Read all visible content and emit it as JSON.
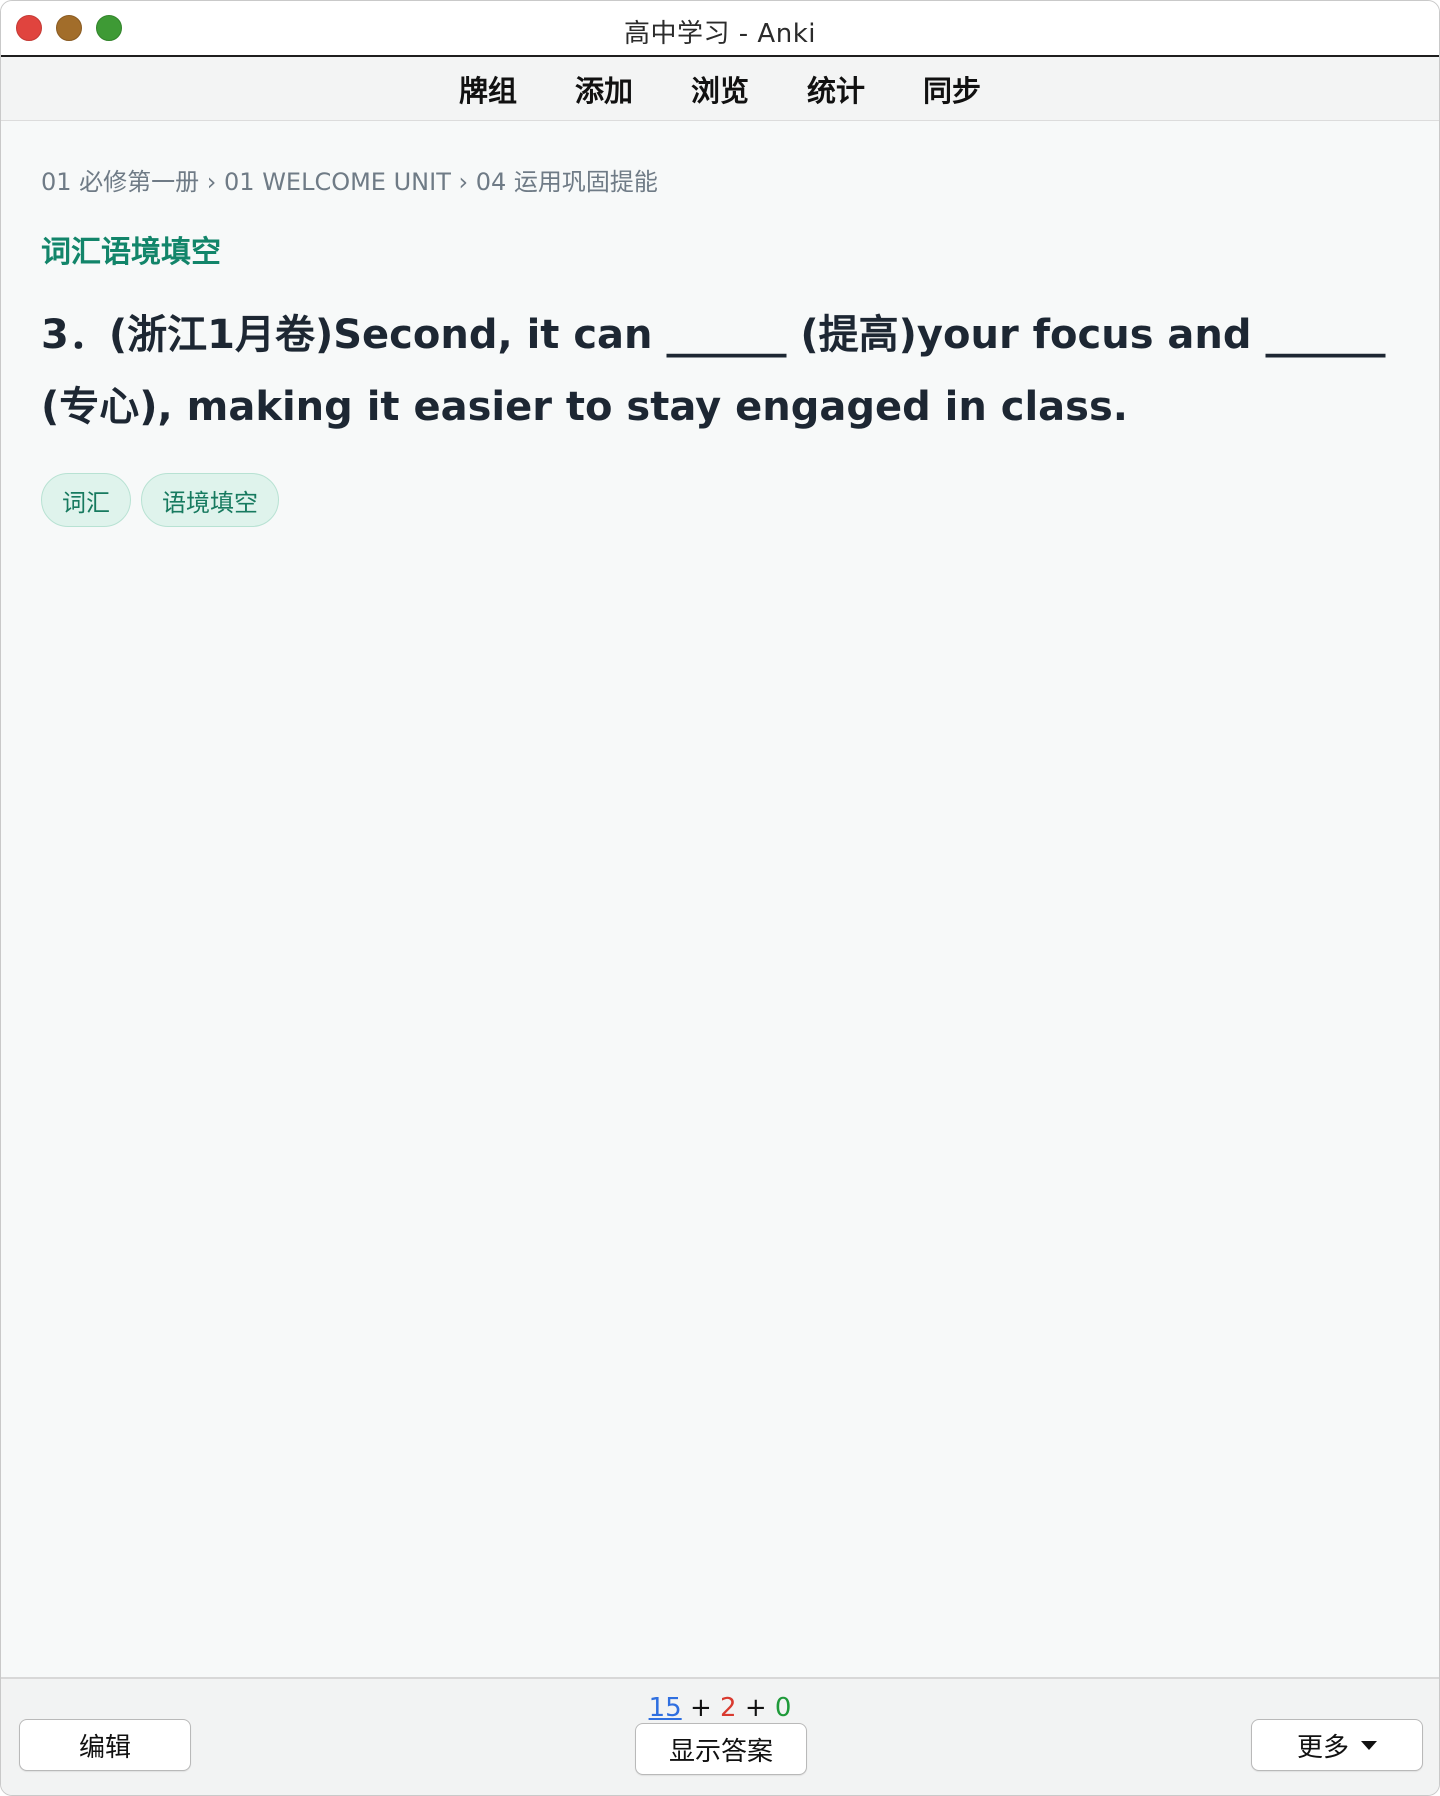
{
  "window": {
    "title": "高中学习 - Anki"
  },
  "toolbar": {
    "items": [
      {
        "label": "牌组"
      },
      {
        "label": "添加"
      },
      {
        "label": "浏览"
      },
      {
        "label": "统计"
      },
      {
        "label": "同步"
      }
    ]
  },
  "card": {
    "breadcrumb": "01 必修第一册 › 01 WELCOME UNIT › 04 运用巩固提能",
    "section_title": "词汇语境填空",
    "question": "3．(浙江1月卷)Second, it can ______ (提高)your focus and ______ (专心), making it easier to stay engaged in class.",
    "tags": [
      "词汇",
      "语境填空"
    ]
  },
  "bottom": {
    "counts": {
      "new": "15",
      "learn": "2",
      "review": "0",
      "sep1": "+",
      "sep2": "+"
    },
    "edit_label": "编辑",
    "show_answer_label": "显示答案",
    "more_label": "更多"
  },
  "colors": {
    "accent_green": "#12856a",
    "new_count": "#2f6fe0",
    "learn_count": "#d93a2f",
    "review_count": "#1f9a3a"
  },
  "icons": {
    "more_caret": "caret-down-icon"
  }
}
